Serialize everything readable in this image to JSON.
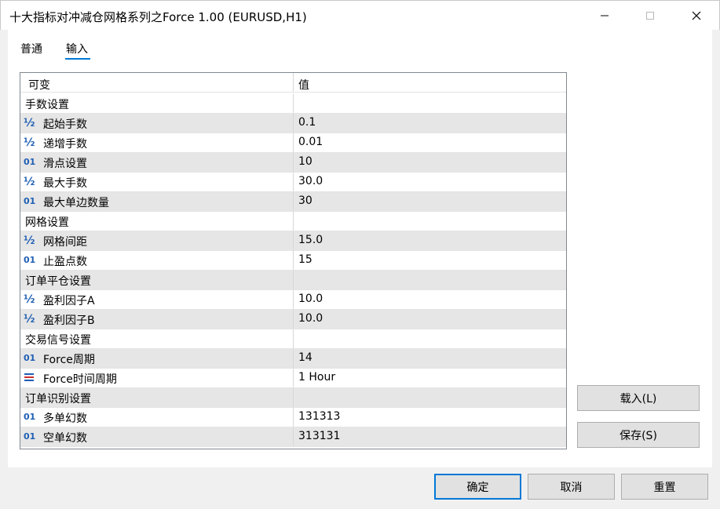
{
  "window": {
    "title": "十大指标对冲减仓网格系列之Force 1.00 (EURUSD,H1)"
  },
  "tabs": [
    {
      "label": "普通",
      "active": false
    },
    {
      "label": "输入",
      "active": true
    }
  ],
  "grid": {
    "header": {
      "name": "可变",
      "value": "值"
    },
    "rows": [
      {
        "type": "group",
        "name": "手数设置",
        "value": ""
      },
      {
        "type": "param",
        "icon": "fraction-icon",
        "name": "起始手数",
        "value": "0.1"
      },
      {
        "type": "param",
        "icon": "fraction-icon",
        "name": "递增手数",
        "value": "0.01"
      },
      {
        "type": "param",
        "icon": "integer-icon",
        "name": "滑点设置",
        "value": "10"
      },
      {
        "type": "param",
        "icon": "fraction-icon",
        "name": "最大手数",
        "value": "30.0"
      },
      {
        "type": "param",
        "icon": "integer-icon",
        "name": "最大单边数量",
        "value": "30"
      },
      {
        "type": "group",
        "name": "网格设置",
        "value": ""
      },
      {
        "type": "param",
        "icon": "fraction-icon",
        "name": "网格间距",
        "value": "15.0"
      },
      {
        "type": "param",
        "icon": "integer-icon",
        "name": "止盈点数",
        "value": "15"
      },
      {
        "type": "group",
        "name": "订单平仓设置",
        "value": ""
      },
      {
        "type": "param",
        "icon": "fraction-icon",
        "name": "盈利因子A",
        "value": "10.0"
      },
      {
        "type": "param",
        "icon": "fraction-icon",
        "name": "盈利因子B",
        "value": "10.0"
      },
      {
        "type": "group",
        "name": "交易信号设置",
        "value": ""
      },
      {
        "type": "param",
        "icon": "integer-icon",
        "name": "Force周期",
        "value": "14"
      },
      {
        "type": "param",
        "icon": "enum-icon",
        "name": "Force时间周期",
        "value": "1 Hour"
      },
      {
        "type": "group",
        "name": "订单识别设置",
        "value": ""
      },
      {
        "type": "param",
        "icon": "integer-icon",
        "name": "多单幻数",
        "value": "131313"
      },
      {
        "type": "param",
        "icon": "integer-icon",
        "name": "空单幻数",
        "value": "313131"
      }
    ]
  },
  "side_buttons": {
    "load": "载入(L)",
    "save": "保存(S)"
  },
  "footer": {
    "ok": "确定",
    "cancel": "取消",
    "reset": "重置"
  },
  "icon_glyphs": {
    "fraction-icon": "½",
    "integer-icon": "01",
    "enum-icon": "≡"
  },
  "colors": {
    "accent": "#0078d7",
    "icon_blue": "#1f5fb4",
    "enum_red": "#d03030",
    "row_alt": "#e6e6e6"
  }
}
